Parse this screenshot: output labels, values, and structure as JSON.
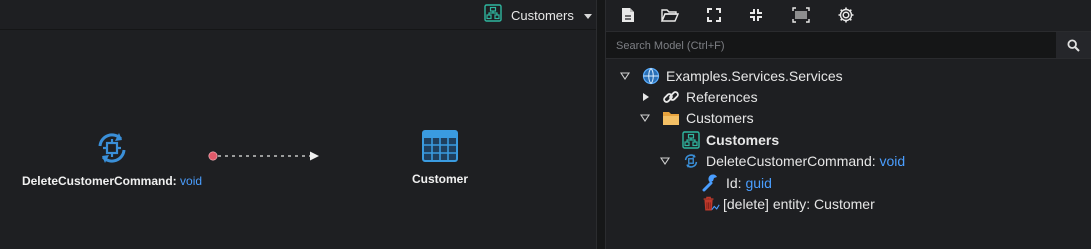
{
  "canvas": {
    "diagram_selector": {
      "icon": "diagram-icon",
      "label": "Customers"
    },
    "command_node": {
      "icon": "command-icon",
      "name": "DeleteCustomerCommand:",
      "type": "void"
    },
    "entity_node": {
      "icon": "entity-table-icon",
      "name": "Customer"
    }
  },
  "toolbar": {
    "buttons": [
      "new-file-icon",
      "open-folder-icon",
      "expand-icon",
      "collapse-icon",
      "barcode-icon",
      "settings-gear-icon"
    ]
  },
  "search": {
    "placeholder": "Search Model (Ctrl+F)",
    "value": ""
  },
  "tree": {
    "root": {
      "label": "Examples.Services.Services",
      "icon": "services-globe-icon"
    },
    "references": {
      "label": "References",
      "icon": "link-icon"
    },
    "customers_folder": {
      "label": "Customers",
      "icon": "folder-open-icon"
    },
    "customers_diagram": {
      "label": "Customers",
      "icon": "diagram-icon"
    },
    "delete_command": {
      "label": "DeleteCustomerCommand:",
      "type": "void",
      "icon": "command-icon"
    },
    "id_field": {
      "label": "Id:",
      "type": "guid",
      "icon": "wrench-icon"
    },
    "delete_mapping": {
      "label": "[delete] entity: Customer",
      "icon": "trash-mapping-icon"
    }
  },
  "colors": {
    "background": "#1e1f22",
    "accent_type": "#4a9eff",
    "diagram_green": "#2fb7a0",
    "command_blue": "#3a8fd8",
    "folder_orange": "#e8a33d",
    "delete_red": "#c0392b"
  }
}
